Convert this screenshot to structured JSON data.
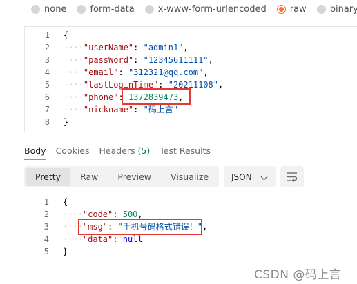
{
  "body_types": [
    {
      "label": "none",
      "selected": false
    },
    {
      "label": "form-data",
      "selected": false
    },
    {
      "label": "x-www-form-urlencoded",
      "selected": false
    },
    {
      "label": "raw",
      "selected": true
    },
    {
      "label": "binary",
      "selected": false
    },
    {
      "label": "G",
      "selected": false
    }
  ],
  "request_lines": [
    {
      "num": "1",
      "parts": [
        {
          "t": "{",
          "c": "p"
        }
      ]
    },
    {
      "num": "2",
      "parts": [
        {
          "t": "····",
          "c": "ws"
        },
        {
          "t": "\"userName\"",
          "c": "k"
        },
        {
          "t": ": ",
          "c": "p"
        },
        {
          "t": "\"admin1\"",
          "c": "s"
        },
        {
          "t": ",",
          "c": "p"
        }
      ]
    },
    {
      "num": "3",
      "parts": [
        {
          "t": "····",
          "c": "ws"
        },
        {
          "t": "\"passWord\"",
          "c": "k"
        },
        {
          "t": ": ",
          "c": "p"
        },
        {
          "t": "\"12345611111\"",
          "c": "s"
        },
        {
          "t": ",",
          "c": "p"
        }
      ]
    },
    {
      "num": "4",
      "parts": [
        {
          "t": "····",
          "c": "ws"
        },
        {
          "t": "\"email\"",
          "c": "k"
        },
        {
          "t": ": ",
          "c": "p"
        },
        {
          "t": "\"312321@qq.com\"",
          "c": "s"
        },
        {
          "t": ",",
          "c": "p"
        }
      ]
    },
    {
      "num": "5",
      "parts": [
        {
          "t": "····",
          "c": "ws"
        },
        {
          "t": "\"lastLoginTime\"",
          "c": "k"
        },
        {
          "t": ": ",
          "c": "p"
        },
        {
          "t": "\"20211108\"",
          "c": "s"
        },
        {
          "t": ",",
          "c": "p"
        }
      ]
    },
    {
      "num": "6",
      "parts": [
        {
          "t": "····",
          "c": "ws"
        },
        {
          "t": "\"phone\"",
          "c": "k"
        },
        {
          "t": ": ",
          "c": "p"
        },
        {
          "t": "1372839473",
          "c": "n"
        },
        {
          "t": ",",
          "c": "p"
        }
      ]
    },
    {
      "num": "7",
      "parts": [
        {
          "t": "····",
          "c": "ws"
        },
        {
          "t": "\"nickname\"",
          "c": "k"
        },
        {
          "t": ": ",
          "c": "p"
        },
        {
          "t": "\"码上言\"",
          "c": "s"
        }
      ]
    },
    {
      "num": "8",
      "parts": [
        {
          "t": "}",
          "c": "p"
        }
      ]
    }
  ],
  "response_tabs": {
    "body": "Body",
    "cookies": "Cookies",
    "headers": "Headers",
    "headers_count": "(5)",
    "test_results": "Test Results"
  },
  "format_options": [
    "Pretty",
    "Raw",
    "Preview",
    "Visualize"
  ],
  "format_selected": "Pretty",
  "language": "JSON",
  "response_lines": [
    {
      "num": "1",
      "parts": [
        {
          "t": "{",
          "c": "p"
        }
      ]
    },
    {
      "num": "2",
      "parts": [
        {
          "t": "····",
          "c": "ws"
        },
        {
          "t": "\"code\"",
          "c": "k"
        },
        {
          "t": ": ",
          "c": "p"
        },
        {
          "t": "500",
          "c": "n"
        },
        {
          "t": ",",
          "c": "p"
        }
      ]
    },
    {
      "num": "3",
      "parts": [
        {
          "t": "····",
          "c": "ws"
        },
        {
          "t": "\"msg\"",
          "c": "k"
        },
        {
          "t": ": ",
          "c": "p"
        },
        {
          "t": "\"手机号码格式错误！\"",
          "c": "s"
        },
        {
          "t": ",",
          "c": "p"
        }
      ]
    },
    {
      "num": "4",
      "parts": [
        {
          "t": "····",
          "c": "ws"
        },
        {
          "t": "\"data\"",
          "c": "k"
        },
        {
          "t": ": ",
          "c": "p"
        },
        {
          "t": "null",
          "c": "kw"
        }
      ]
    },
    {
      "num": "5",
      "parts": [
        {
          "t": "}",
          "c": "p"
        }
      ]
    }
  ],
  "watermark": "CSDN @码上言",
  "colors": {
    "accent": "#ff6c37",
    "highlight": "#e53935",
    "key": "#a31515",
    "string": "#0451a5",
    "number": "#098658",
    "keyword": "#0000ff"
  }
}
